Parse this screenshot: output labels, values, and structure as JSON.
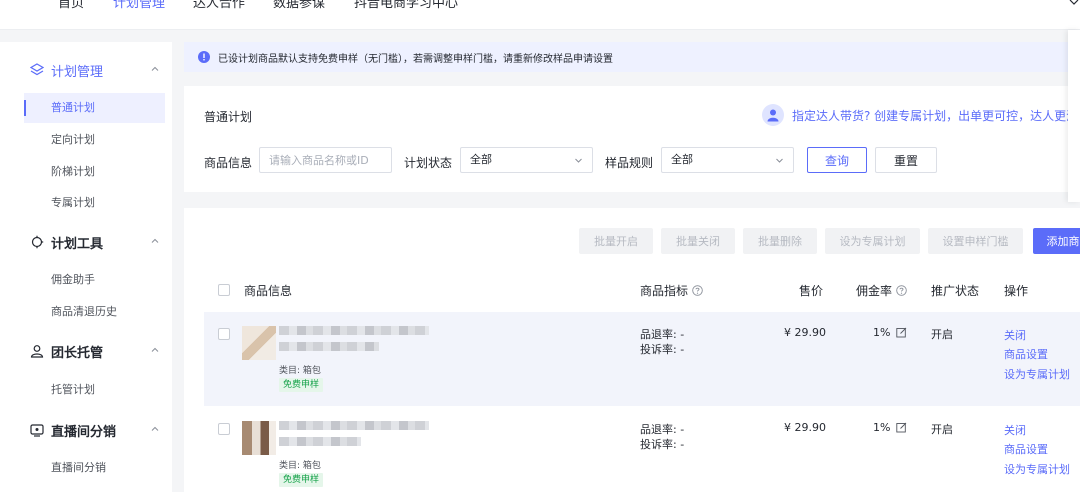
{
  "topnav": {
    "tabs": [
      "首页",
      "计划管理",
      "达人合作",
      "数据参谋",
      "抖音电商学习中心"
    ]
  },
  "sidebar": {
    "groups": [
      {
        "title": "计划管理",
        "icon": "layers-icon",
        "items": [
          "普通计划",
          "定向计划",
          "阶梯计划",
          "专属计划"
        ]
      },
      {
        "title": "计划工具",
        "icon": "tools-icon",
        "items": [
          "佣金助手",
          "商品清退历史"
        ]
      },
      {
        "title": "团长托管",
        "icon": "users-icon",
        "items": [
          "托管计划"
        ]
      },
      {
        "title": "直播间分销",
        "icon": "live-tv-icon",
        "items": [
          "直播间分销"
        ]
      }
    ]
  },
  "notice": {
    "text": "已设计划商品默认支持免费申样（无门槛），若需调整申样门槛，请重新修改样品申请设置"
  },
  "filter": {
    "title": "普通计划",
    "promo_text": "指定达人带货? 创建专属计划，出单更可控，达人更满",
    "product_label": "商品信息",
    "product_placeholder": "请输入商品名称或ID",
    "status_label": "计划状态",
    "status_value": "全部",
    "sample_label": "样品规则",
    "sample_value": "全部",
    "query_label": "查询",
    "reset_label": "重置"
  },
  "bulk_actions": [
    "批量开启",
    "批量关闭",
    "批量删除",
    "设为专属计划",
    "设置申样门槛",
    "添加商"
  ],
  "table": {
    "headers": {
      "product": "商品信息",
      "metrics": "商品指标",
      "price": "售价",
      "commission": "佣金率",
      "status": "推广状态",
      "ops": "操作"
    },
    "rows": [
      {
        "category": "类目: 箱包",
        "tag": "免费申样",
        "refund": "品退率: -",
        "complaint": "投诉率: -",
        "price": "¥ 29.90",
        "commission": "1%",
        "status": "开启",
        "ops": [
          "关闭",
          "商品设置",
          "设为专属计划"
        ]
      },
      {
        "category": "类目: 箱包",
        "tag": "免费申样",
        "refund": "品退率: -",
        "complaint": "投诉率: -",
        "price": "¥ 29.90",
        "commission": "1%",
        "status": "开启",
        "ops": [
          "关闭",
          "商品设置",
          "设为专属计划"
        ]
      }
    ]
  },
  "colors": {
    "accent": "#5b6cf9",
    "tag_green": "#16a34a",
    "notice_bg": "#eef1ff"
  }
}
